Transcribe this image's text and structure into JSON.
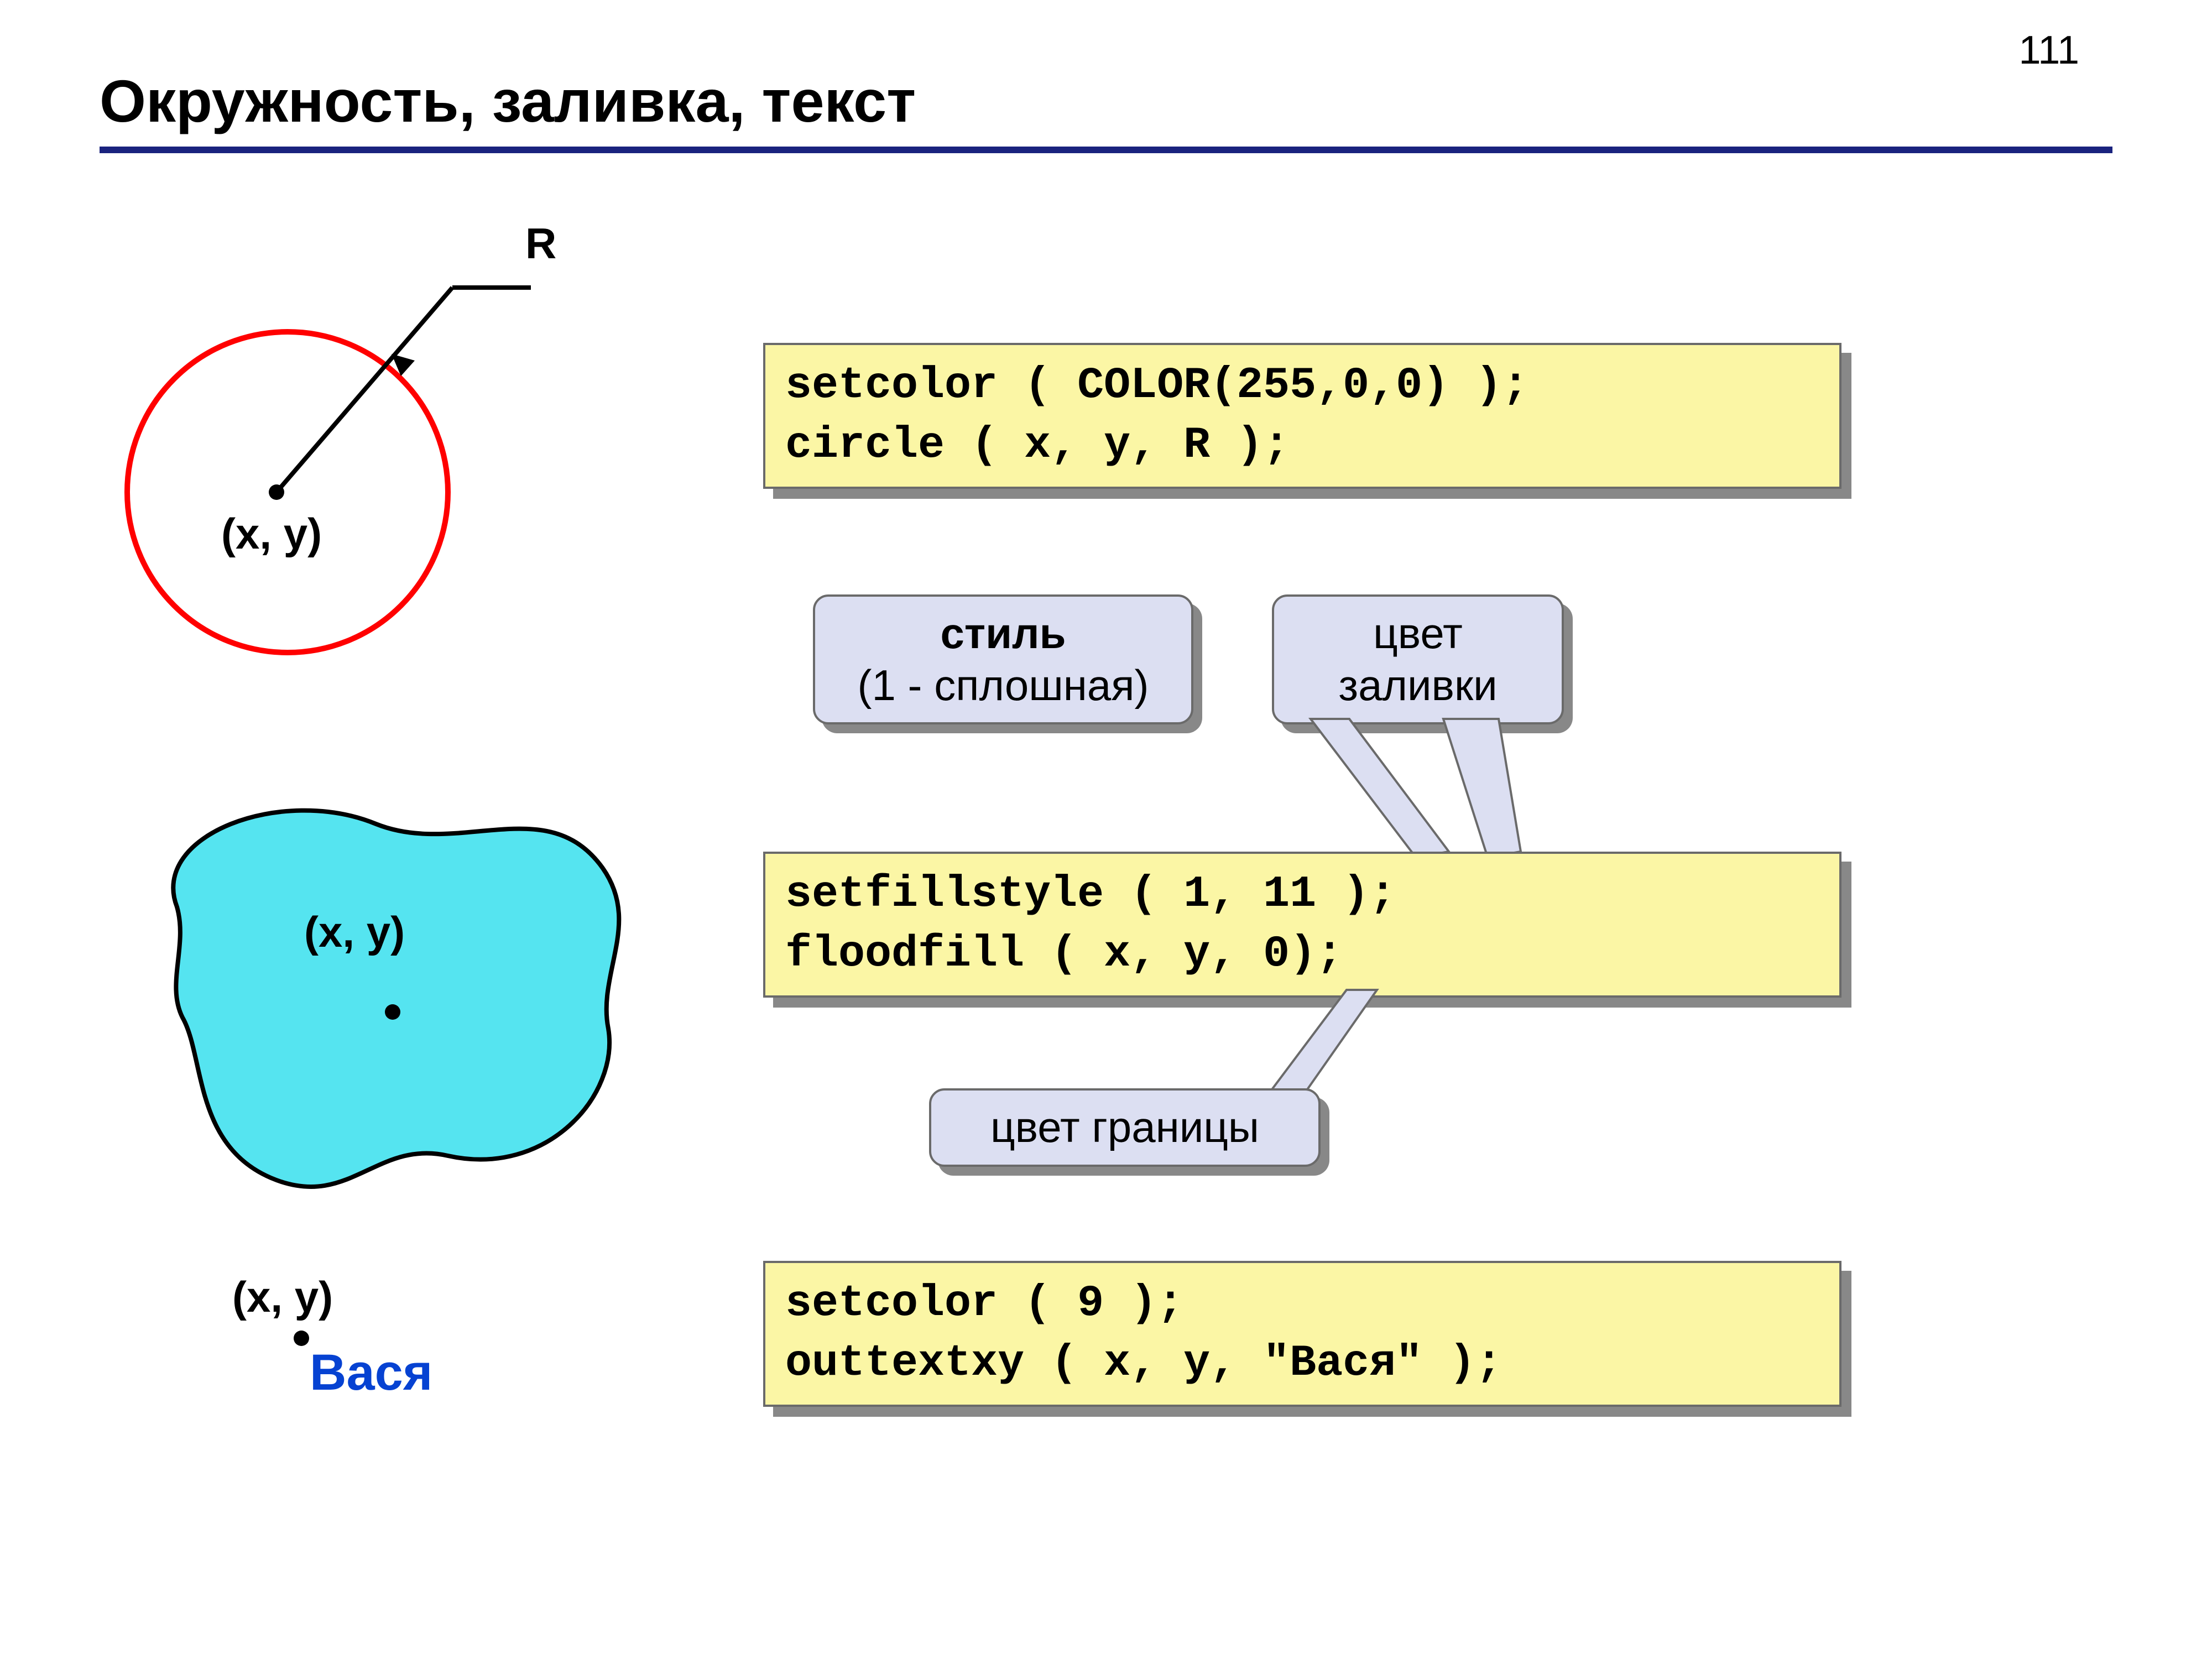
{
  "page_number": "111",
  "title": "Окружность, заливка, текст",
  "illus": {
    "radius_label": "R",
    "xy_label": "(x, y)",
    "text_sample": "Вася"
  },
  "code": {
    "block1": "setcolor ( COLOR(255,0,0) );\ncircle ( x, y, R );",
    "block2": "setfillstyle ( 1, 11 );\nfloodfill ( x, y, 0);",
    "block3": "setcolor ( 9 );\nouttextxy ( x, y, \"Вася\" );"
  },
  "callouts": {
    "style_title": "стиль",
    "style_sub": "(1 - сплошная)",
    "fill_color": "цвет\nзаливки",
    "border_color": "цвет границы"
  }
}
